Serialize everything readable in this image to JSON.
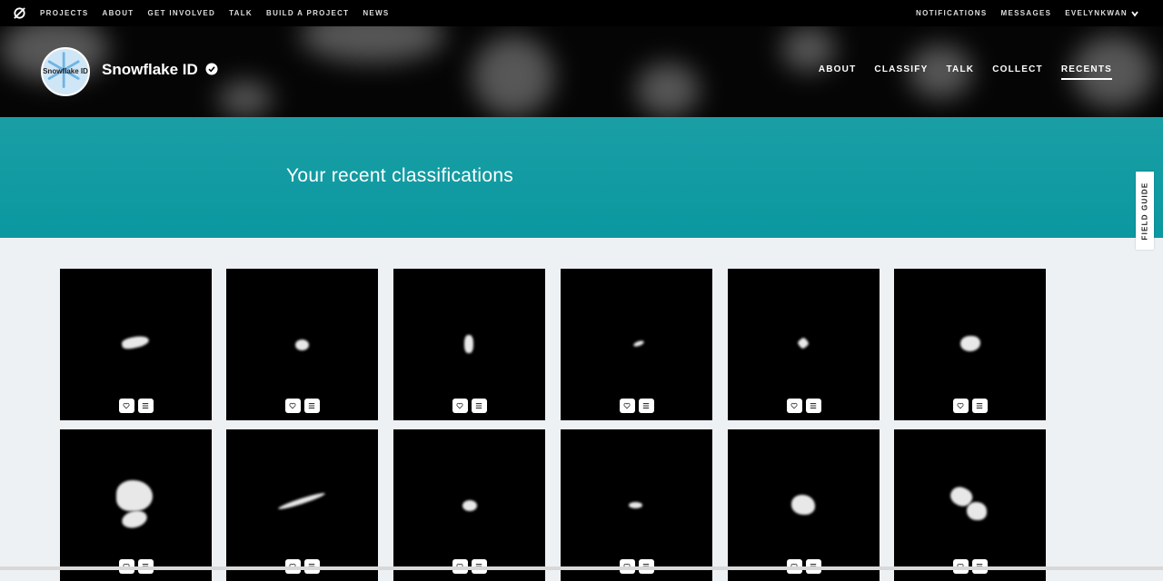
{
  "topnav": {
    "left": [
      "PROJECTS",
      "ABOUT",
      "GET INVOLVED",
      "TALK",
      "BUILD A PROJECT",
      "NEWS"
    ],
    "right": [
      "NOTIFICATIONS",
      "MESSAGES",
      "EVELYNKWAN"
    ]
  },
  "project": {
    "title": "Snowflake ID",
    "avatar_text": "Snowflake ID",
    "nav": [
      "ABOUT",
      "CLASSIFY",
      "TALK",
      "COLLECT",
      "RECENTS"
    ],
    "active_nav": "RECENTS"
  },
  "banner": {
    "title": "Your recent classifications"
  },
  "field_guide": {
    "label": "FIELD GUIDE"
  },
  "colors": {
    "banner": "#0b98a0",
    "topbar": "#000000",
    "page_bg": "#eef1f4"
  },
  "cards": {
    "count": 12,
    "icons": [
      "heart-icon",
      "list-icon"
    ]
  }
}
